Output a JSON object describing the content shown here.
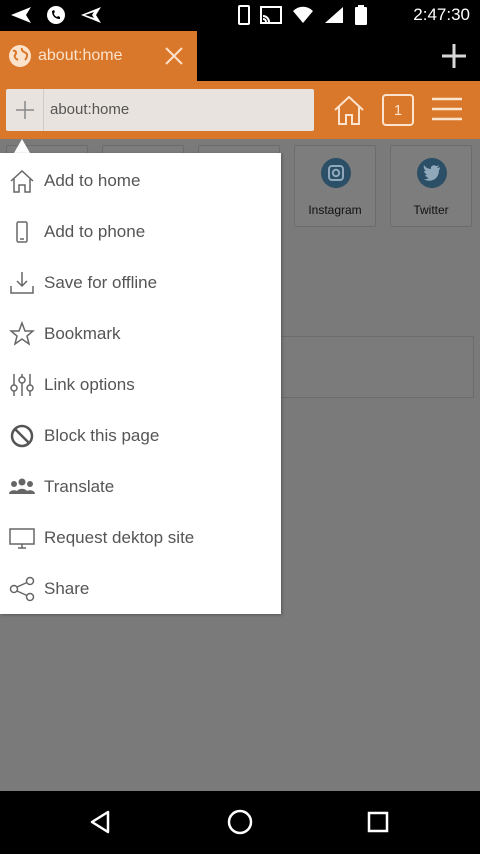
{
  "status_bar": {
    "time": "2:47:30",
    "left_icons": [
      "back-arrow-icon",
      "phone-icon",
      "send-icon"
    ],
    "right_icons": [
      "phone-device-icon",
      "cast-icon",
      "wifi-icon",
      "signal-icon",
      "battery-icon"
    ]
  },
  "tab_strip": {
    "tab_title": "about:home",
    "tab_icon": "globe-icon"
  },
  "address_bar": {
    "url": "about:home",
    "tabs_count": "1"
  },
  "page": {
    "tiles": [
      {
        "label": "",
        "icon": ""
      },
      {
        "label": "",
        "icon": ""
      },
      {
        "label": "",
        "icon": ""
      },
      {
        "label": "Instagram",
        "icon": "instagram-icon"
      },
      {
        "label": "Twitter",
        "icon": "twitter-icon"
      }
    ]
  },
  "menu": {
    "items": [
      {
        "label": "Add to home",
        "icon": "home-icon"
      },
      {
        "label": "Add to phone",
        "icon": "phone-icon"
      },
      {
        "label": "Save for offline",
        "icon": "download-icon"
      },
      {
        "label": "Bookmark",
        "icon": "star-icon"
      },
      {
        "label": "Link options",
        "icon": "sliders-icon"
      },
      {
        "label": "Block this page",
        "icon": "block-icon"
      },
      {
        "label": "Translate",
        "icon": "people-icon"
      },
      {
        "label": "Request dektop site",
        "icon": "desktop-icon"
      },
      {
        "label": "Share",
        "icon": "share-icon"
      }
    ]
  },
  "colors": {
    "accent": "#d9772a",
    "menu_text": "#555555",
    "tile_icon": "#2b4f66"
  }
}
